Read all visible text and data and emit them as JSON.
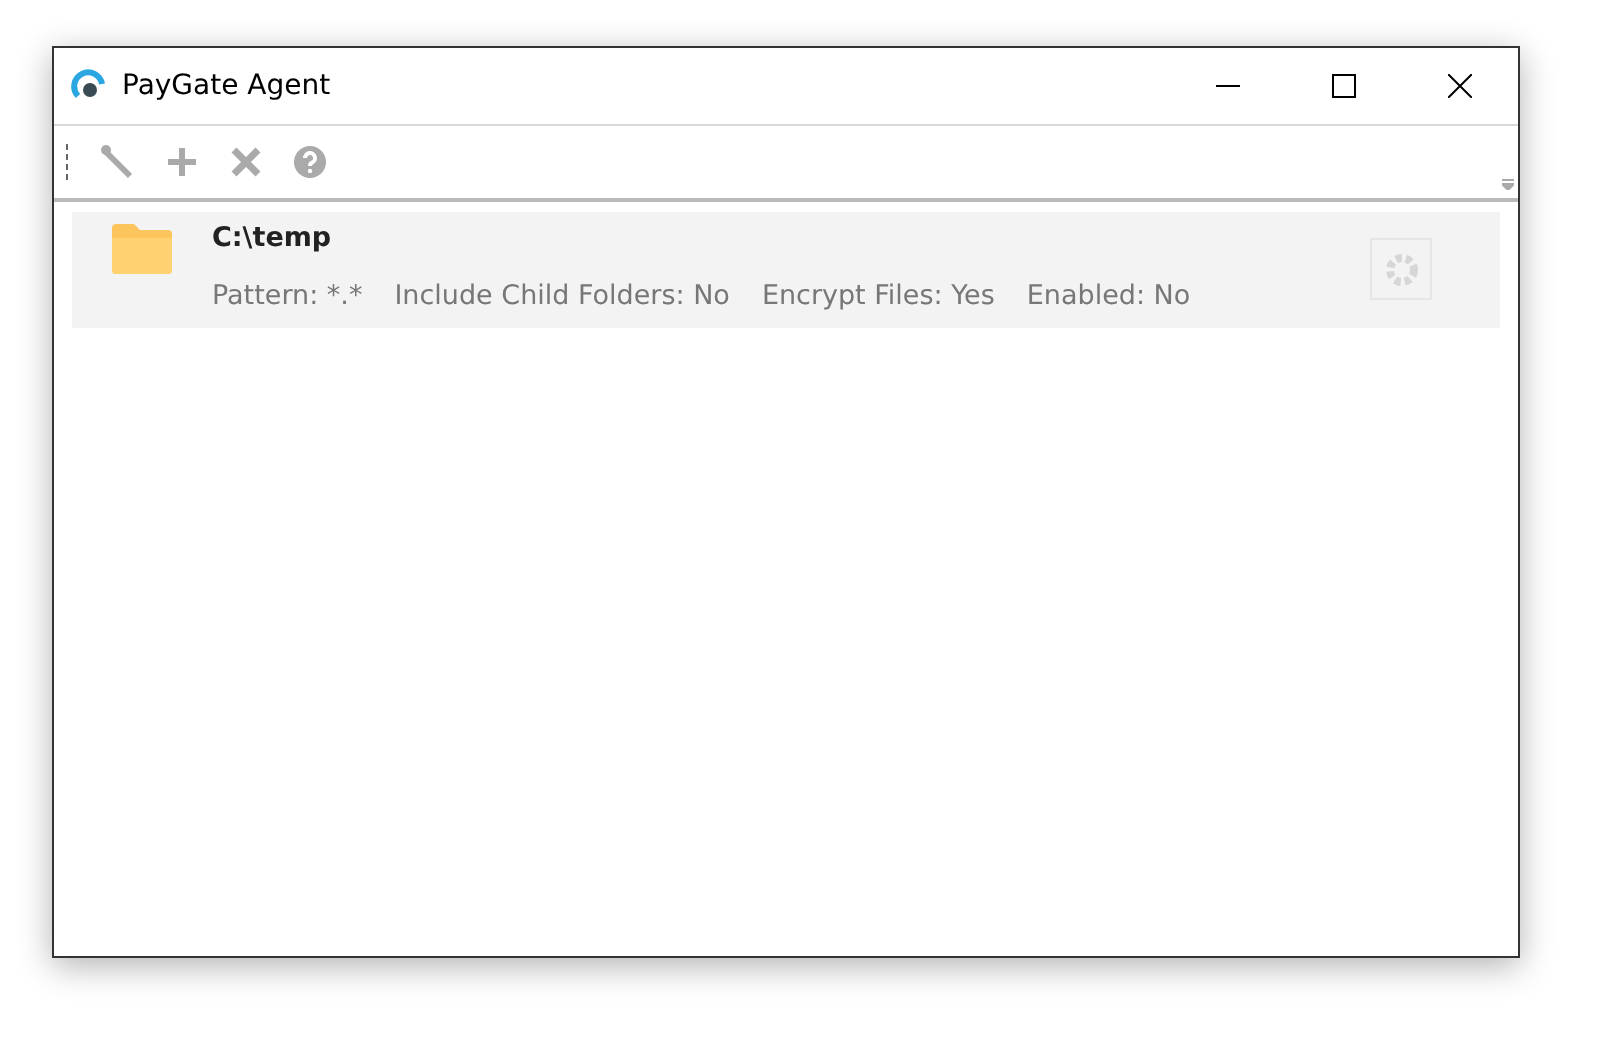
{
  "window": {
    "title": "PayGate Agent"
  },
  "folders": [
    {
      "path": "C:\\temp",
      "details": [
        "Pattern: *.*",
        "Include Child Folders: No",
        "Encrypt Files: Yes",
        "Enabled: No"
      ]
    }
  ]
}
